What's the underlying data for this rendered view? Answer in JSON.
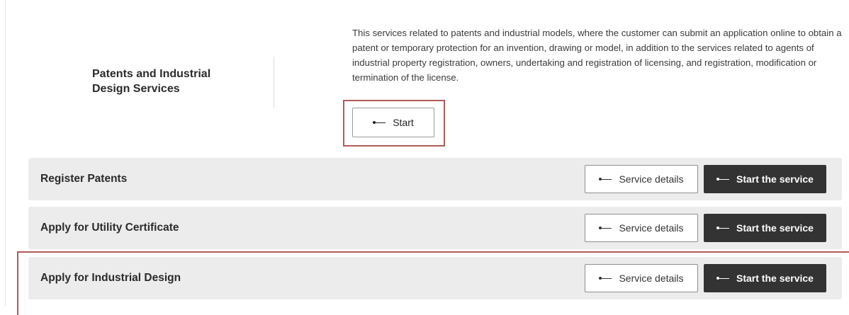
{
  "category": {
    "title_line1": "Patents and Industrial",
    "title_line2": "Design Services",
    "description": "This services related to patents and industrial models, where the customer can submit an application online to obtain a patent or temporary protection for an invention, drawing or model, in addition to the services related to agents of industrial property registration, owners, undertaking and registration of licensing, and registration, modification or termination of the license.",
    "start_label": "Start"
  },
  "services": [
    {
      "title": "Register Patents",
      "details_label": "Service details",
      "start_label": "Start the service"
    },
    {
      "title": "Apply for Utility Certificate",
      "details_label": "Service details",
      "start_label": "Start the service"
    },
    {
      "title": "Apply for Industrial Design",
      "details_label": "Service details",
      "start_label": "Start the service"
    }
  ],
  "colors": {
    "highlight": "#b15a57",
    "row_background": "#ececec",
    "primary_button": "#333333"
  },
  "icons": {
    "button_arrow": "arrow-left-icon"
  }
}
